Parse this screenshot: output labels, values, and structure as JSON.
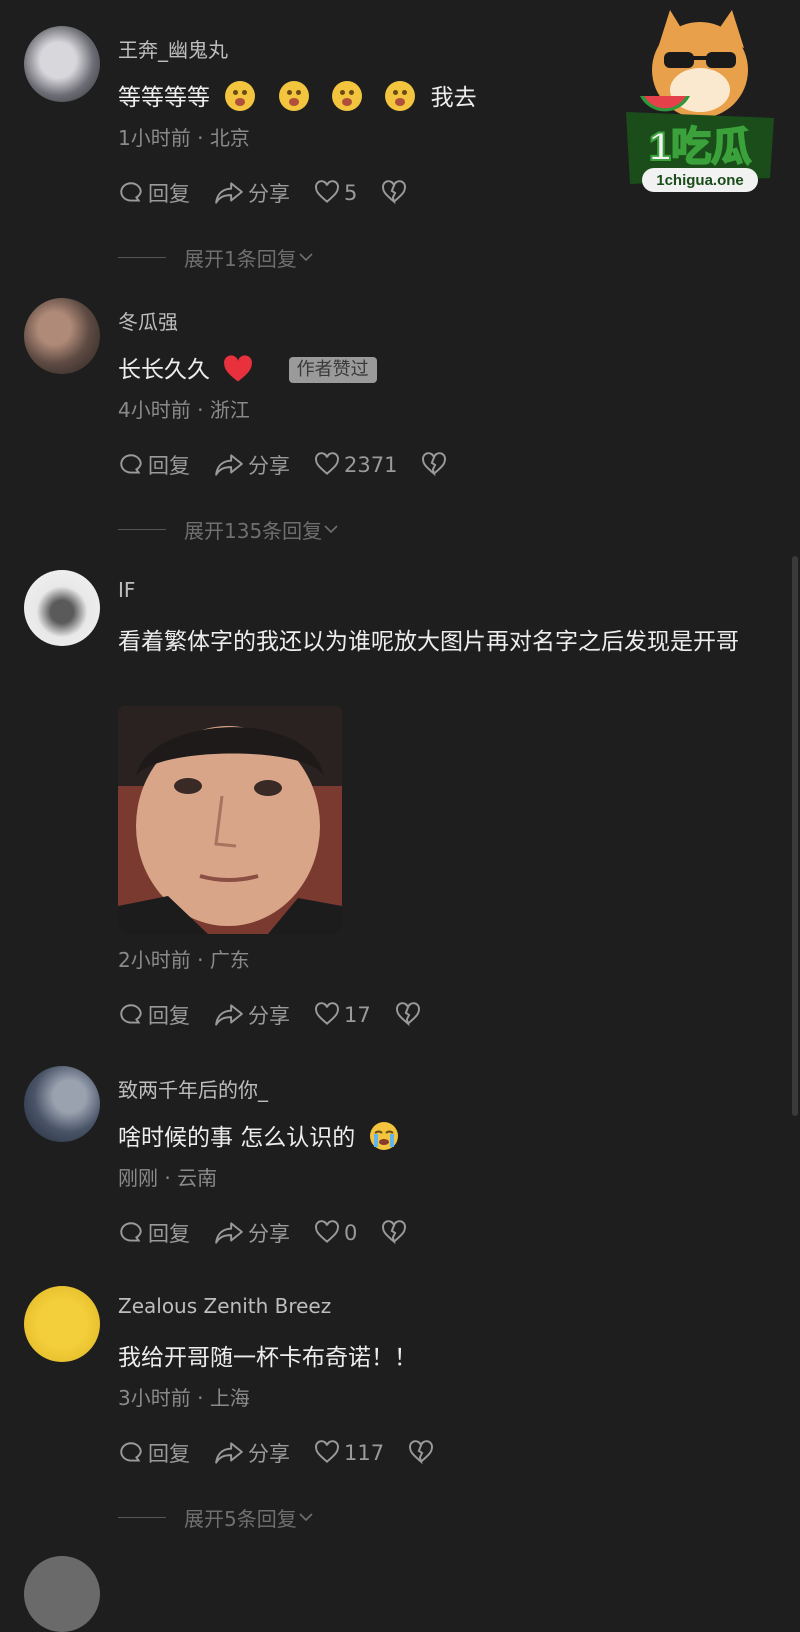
{
  "logo": {
    "text": "1吃瓜",
    "domain": "1chigua.one"
  },
  "actions": {
    "reply_label": "回复",
    "share_label": "分享"
  },
  "comments": [
    {
      "username": "王奔_幽鬼丸",
      "text_pre": "等等等等",
      "text_post": "我去",
      "time": "1小时前",
      "location": "北京",
      "likes": "5",
      "expand": "展开1条回复"
    },
    {
      "username": "冬瓜强",
      "text": "长长久久",
      "badge": "作者赞过",
      "time": "4小时前",
      "location": "浙江",
      "likes": "2371",
      "expand": "展开135条回复"
    },
    {
      "username": "IF",
      "text": "看着繁体字的我还以为谁呢放大图片再对名字之后发现是开哥",
      "time": "2小时前",
      "location": "广东",
      "likes": "17"
    },
    {
      "username": "致两千年后的你_",
      "text": "啥时候的事 怎么认识的",
      "time": "刚刚",
      "location": "云南",
      "likes": "0"
    },
    {
      "username": "Zealous Zenith Breez",
      "text": "我给开哥随一杯卡布奇诺！！",
      "time": "3小时前",
      "location": "上海",
      "likes": "117",
      "expand": "展开5条回复"
    }
  ],
  "colors": {
    "background": "#1e1e1f",
    "text": "#ededed",
    "secondary": "#8a8a8a",
    "heart": "#e8313d",
    "badge": "#9a9a9a"
  }
}
